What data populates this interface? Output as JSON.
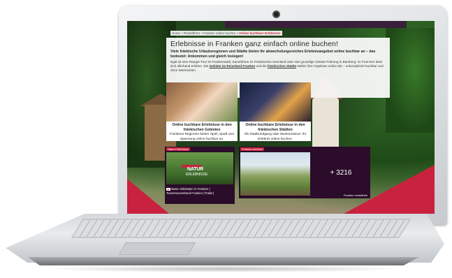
{
  "breadcrumb": {
    "path": "Home » Reiseführer » Franken online buchen » ",
    "current": "Online buchbare Erlebnisse"
  },
  "hero": {
    "title": "Erlebnisse in Franken ganz einfach online buchen!",
    "subtitle": "Viele fränkische Urlaubsregionen und Städte bieten ihr abwechslungsreiches Erlebnisangebot online buchbar an – das bedeutet: Ankommen und gleich loslegen!",
    "body_part1": "Egal ob eine Ranger-Tour im Frankenwald, Kanufahren im Fränkischen Seenland oder eine gruselige Geister-Führung in Bamberg: im Fran-ken lässt sich allerhand erleben. Die ",
    "link1": "Gebiete im Reiseland Franken",
    "body_part2": " und die ",
    "link2": "fränkischen Städte",
    "body_part3": " stellen ihre Angebote online dar – unkompliziert buchbar und ohne Wartezeiten."
  },
  "cards": [
    {
      "title": "Online buchbare Erlebnisse in den fränkischen Gebieten",
      "text": "Frankens Regionen bieten Spiel, Spaß und Spannung online buchbar an."
    },
    {
      "title": "Online buchbare Erlebnisse in den fränkischen Städten",
      "text": "Ob Stadtrundgang oder Museumstour: Ihr Erlebnis online buchen."
    }
  ],
  "tiles": {
    "video": {
      "tag": "Natur-Erlebnisse",
      "logo_top": "NATUR",
      "logo_bottom": "ERLEBNISSE",
      "caption": "Natur-Aktivitäten in Franken | Tourismusverband Franken (Trailer)",
      "icon": "play-icon"
    },
    "photos": {
      "tag": "Franken erleben!",
      "count": "+ 3216",
      "brand": "Franken mediathek"
    }
  },
  "colors": {
    "accent": "#c8223f",
    "tile_bg": "#2b0c2a"
  }
}
